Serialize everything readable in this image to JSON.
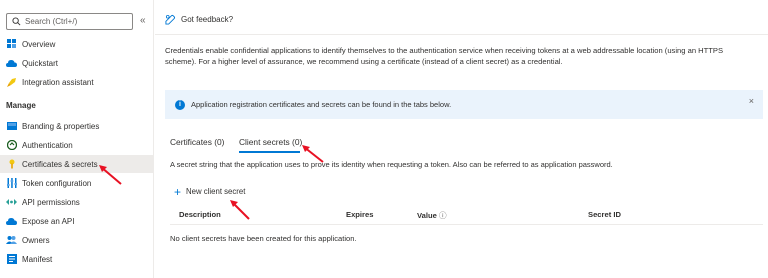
{
  "sidebar": {
    "search_placeholder": "Search (Ctrl+/)",
    "collapse_icon": "«",
    "items_top": [
      {
        "label": "Overview",
        "icon": "grid-icon"
      },
      {
        "label": "Quickstart",
        "icon": "cloud-icon"
      },
      {
        "label": "Integration assistant",
        "icon": "rocket-icon"
      }
    ],
    "section_manage": "Manage",
    "items_manage": [
      {
        "label": "Branding & properties",
        "icon": "branding-icon"
      },
      {
        "label": "Authentication",
        "icon": "auth-icon"
      },
      {
        "label": "Certificates & secrets",
        "icon": "key-icon"
      },
      {
        "label": "Token configuration",
        "icon": "token-icon"
      },
      {
        "label": "API permissions",
        "icon": "api-icon"
      },
      {
        "label": "Expose an API",
        "icon": "cloud-api-icon"
      },
      {
        "label": "Owners",
        "icon": "owners-icon"
      },
      {
        "label": "Manifest",
        "icon": "manifest-icon"
      }
    ]
  },
  "header": {
    "feedback_label": "Got feedback?"
  },
  "main": {
    "description": "Credentials enable confidential applications to identify themselves to the authentication service when receiving tokens at a web addressable location (using an HTTPS scheme). For a higher level of assurance, we recommend using a certificate (instead of a client secret) as a credential.",
    "info_message": "Application registration certificates and secrets can be found in the tabs below.",
    "info_close": "×",
    "tabs": [
      {
        "label": "Certificates (0)"
      },
      {
        "label": "Client secrets (0)"
      }
    ],
    "secret_description": "A secret string that the application uses to prove its identity when requesting a token. Also can be referred to as application password.",
    "new_secret_plus": "+",
    "new_secret_label": "New client secret",
    "table": {
      "columns": [
        "Description",
        "Expires",
        "Value",
        "Secret ID"
      ],
      "value_info_icon": "ⓘ",
      "empty_message": "No client secrets have been created for this application."
    }
  },
  "colors": {
    "accent": "#0078d4",
    "annotation_arrow": "#e81123",
    "info_bg": "#eaf3fc"
  }
}
